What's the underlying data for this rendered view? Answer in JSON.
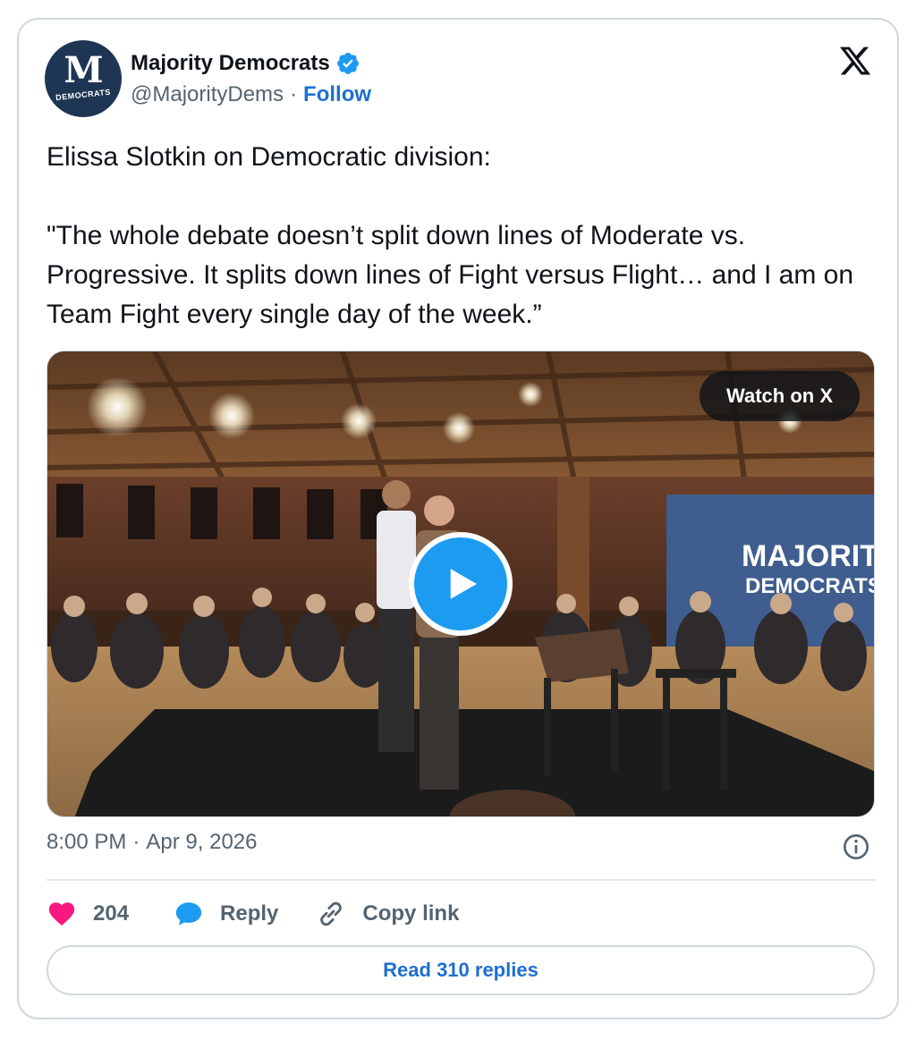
{
  "author": {
    "name": "Majority Democrats",
    "handle": "@MajorityDems",
    "separator": "·",
    "follow_label": "Follow",
    "avatar_letter": "M",
    "avatar_subtext": "DEMOCRATS"
  },
  "tweet": {
    "text": "Elissa Slotkin on Democratic division:\n\n\"The whole debate doesn’t split down lines of Moderate vs. Progressive. It splits down lines of Fight versus Flight… and I am on Team Fight every single day of the week.”"
  },
  "media": {
    "watch_label": "Watch on X",
    "banner_line1": "MAJORITY",
    "banner_line2": "DEMOCRATS"
  },
  "meta": {
    "time": "8:00 PM",
    "separator": "·",
    "date": "Apr 9, 2026"
  },
  "actions": {
    "like_count": "204",
    "reply_label": "Reply",
    "copy_label": "Copy link",
    "read_replies_label": "Read 310 replies"
  },
  "colors": {
    "accent": "#1d9bf0",
    "link": "#1d6fd1",
    "like": "#f91880",
    "muted": "#536471",
    "avatar_bg": "#1f3554"
  },
  "icons": {
    "verified": "verified-badge-icon",
    "logo": "x-logo-icon",
    "play": "play-icon",
    "info": "info-icon",
    "like": "heart-icon",
    "reply": "speech-bubble-icon",
    "copy": "link-icon"
  }
}
